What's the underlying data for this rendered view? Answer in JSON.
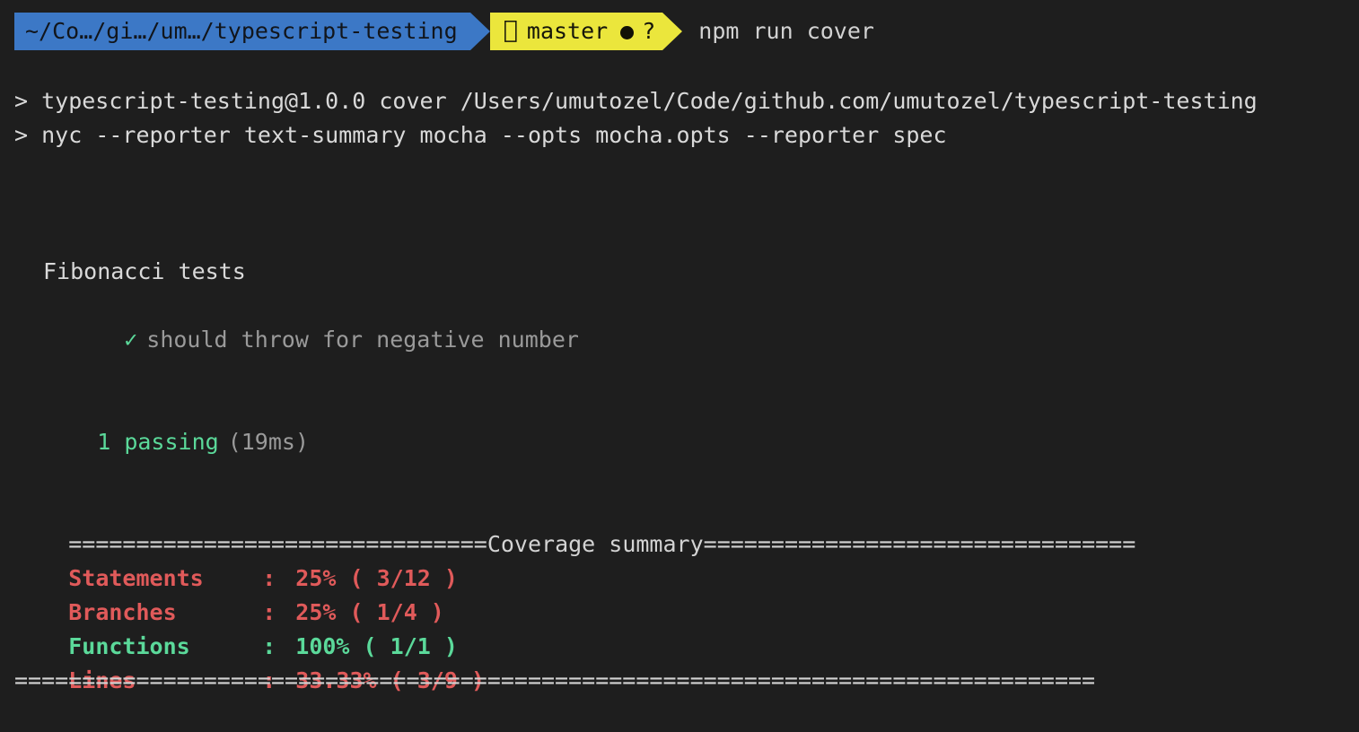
{
  "terminal": {
    "background_color": "#1e1e1e",
    "default_text_color": "#d6d6d6",
    "colors": {
      "path_segment_bg": "#3c78c6",
      "git_segment_bg": "#ebe63c",
      "green": "#5bd99a",
      "red": "#e05a5a",
      "dim": "#9a9a9a",
      "white": "#d9d9d9"
    }
  },
  "prompt": {
    "path": "~/Co…/gi…/um…/typescript-testing",
    "git_icon": "",
    "git_icon_name": "git-branch-icon",
    "git_branch": "master",
    "git_dirty_marker": "●",
    "git_untracked_marker": "?",
    "command": "npm run cover"
  },
  "npm_output": {
    "line1": "> typescript-testing@1.0.0 cover /Users/umutozel/Code/github.com/umutozel/typescript-testing",
    "line2": "> nyc --reporter text-summary mocha --opts mocha.opts --reporter spec"
  },
  "mocha": {
    "suite": "Fibonacci tests",
    "tests": [
      {
        "check": "✓",
        "title": "should throw for negative number"
      }
    ],
    "summary_count": "1 passing",
    "summary_duration": "(19ms)"
  },
  "coverage": {
    "separator_top_left": "===============================",
    "separator_title": "Coverage summary",
    "separator_top_right": "================================",
    "separator_bottom": "================================================================================",
    "rows": [
      {
        "label": "Statements",
        "colon": ":",
        "value": "25% ( 3/12 )",
        "color": "red"
      },
      {
        "label": "Branches",
        "colon": ":",
        "value": "25% ( 1/4 )",
        "color": "red"
      },
      {
        "label": "Functions",
        "colon": ":",
        "value": "100% ( 1/1 )",
        "color": "green"
      },
      {
        "label": "Lines",
        "colon": ":",
        "value": "33.33% ( 3/9 )",
        "color": "red"
      }
    ]
  }
}
